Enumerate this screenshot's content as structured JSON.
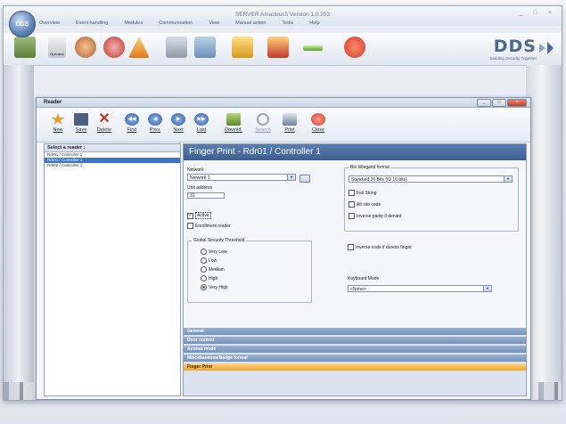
{
  "app": {
    "orb_label": "DDS",
    "title": "SERVER Amadeus5 Version 1.0.253",
    "window_controls": "_ □ ×",
    "ribbon_tabs": [
      "Overview",
      "Event handling",
      "Modules",
      "Communication",
      "View",
      "Manual action",
      "Tools",
      "Help"
    ],
    "ribbon_small_label": "Operator"
  },
  "brand": {
    "logo_text": "DDS",
    "tagline": "Building Security Together"
  },
  "dialog": {
    "title": "Reader",
    "controls": [
      "_",
      "□",
      "×"
    ],
    "toolbar": [
      {
        "label": "New",
        "icon": "star-icon",
        "color": "#e5a12a"
      },
      {
        "label": "Save",
        "icon": "save-icon",
        "color": "#4a5f80"
      },
      {
        "label": "Delete",
        "icon": "delete-icon",
        "color": "#c23a2a"
      },
      {
        "label": "First",
        "icon": "first-icon",
        "color": "#3b6fb6"
      },
      {
        "label": "Prev.",
        "icon": "prev-icon",
        "color": "#3b6fb6"
      },
      {
        "label": "Next",
        "icon": "next-icon",
        "color": "#3b6fb6"
      },
      {
        "label": "Last",
        "icon": "last-icon",
        "color": "#3b6fb6"
      },
      {
        "label": "Downld.",
        "icon": "download-icon",
        "color": "#5a8a2a"
      },
      {
        "label": "Search",
        "icon": "search-icon",
        "color": "#9aa6b6",
        "disabled": true
      },
      {
        "label": "Print",
        "icon": "print-icon",
        "color": "#6d7f98"
      },
      {
        "label": "Close",
        "icon": "close-icon",
        "color": "#d23b2e"
      }
    ],
    "list": {
      "header": "Select a reader :",
      "items": [
        "Rdr01 / Controller 1",
        "Rdr01 / Controller 1",
        "Rdr02 / Controller 1"
      ],
      "selected_index": 1
    },
    "panel_title": "Finger Print - Rdr01 / Controller 1",
    "form": {
      "network_label": "Network",
      "network_value": "Network 1",
      "unit_label": "Unit address",
      "unit_value": "31",
      "active_label": "Active",
      "active_checked": true,
      "enrollment_label": "Enrollment reader",
      "enrollment_checked": false,
      "threshold_title": "Global Security Threshold",
      "threshold_options": [
        "Very Low",
        "Low",
        "Medium",
        "High",
        "Very High"
      ],
      "threshold_selected": "Very High",
      "bio_label": "Bio Wiegand format",
      "bio_value": "Standard 26 Bits (ID 16 bits)",
      "fail_string": "Fail String",
      "alt_site": "Alt site code",
      "inverse_parity": "Inverse parity if denied",
      "inverse_duress": "Inverse code if duress finger",
      "keyboard_label": "Keyboard Mode",
      "keyboard_value": "<None>"
    },
    "sections": [
      "General",
      "Door control",
      "Access mode",
      "Miscellaneous/Badge format",
      "Finger Print"
    ],
    "active_section": "Finger Print"
  }
}
